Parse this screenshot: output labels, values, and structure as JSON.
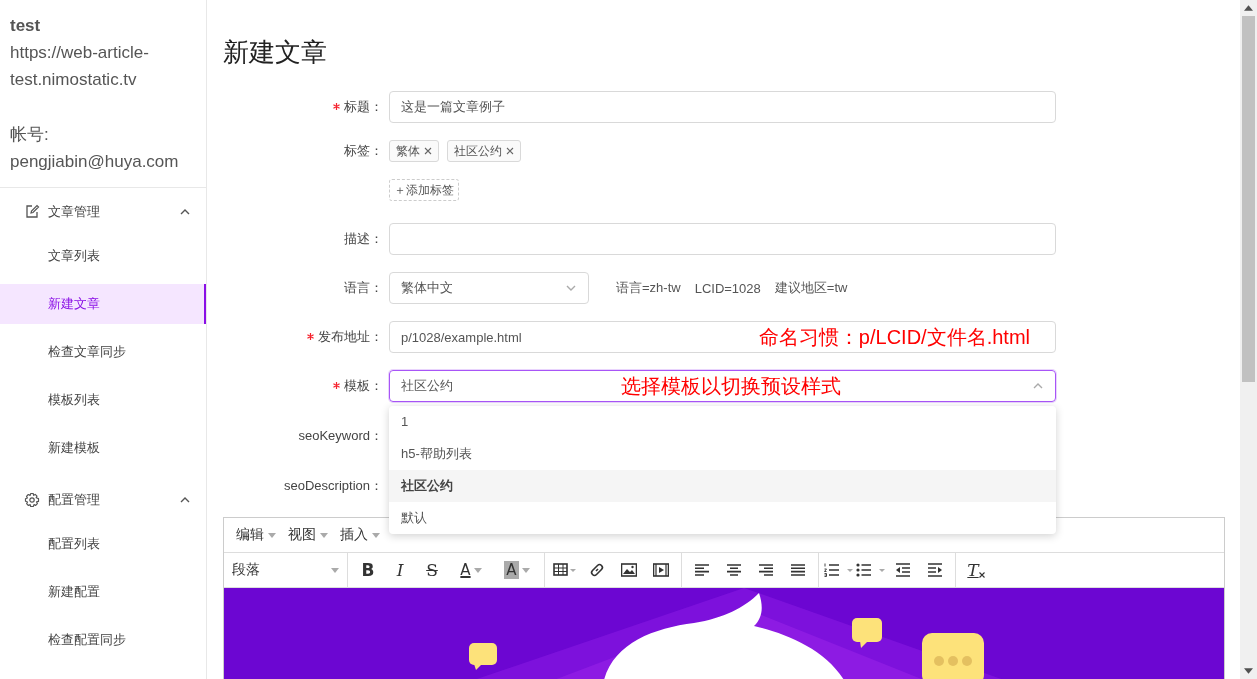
{
  "sidebar": {
    "site_name": "test",
    "site_url": "https://web-article-test.nimostatic.tv",
    "account_label": "帐号:",
    "account": "pengjiabin@huya.com",
    "menu": [
      {
        "label": "文章管理",
        "kind": "edit",
        "expanded": true,
        "children": [
          {
            "label": "文章列表",
            "selected": false
          },
          {
            "label": "新建文章",
            "selected": true
          },
          {
            "label": "检查文章同步",
            "selected": false
          },
          {
            "label": "模板列表",
            "selected": false
          },
          {
            "label": "新建模板",
            "selected": false
          }
        ]
      },
      {
        "label": "配置管理",
        "kind": "gear",
        "expanded": true,
        "children": [
          {
            "label": "配置列表",
            "selected": false
          },
          {
            "label": "新建配置",
            "selected": false
          },
          {
            "label": "检查配置同步",
            "selected": false
          }
        ]
      }
    ]
  },
  "page_title": "新建文章",
  "form": {
    "fields": [
      {
        "kind": "input",
        "label": "标题：",
        "required": true,
        "value": "这是一篇文章例子"
      },
      {
        "kind": "tags",
        "label": "标签：",
        "required": false,
        "tags": [
          "繁体",
          "社区公约"
        ],
        "add_label": "＋添加标签"
      },
      {
        "kind": "input",
        "label": "描述：",
        "required": false
      },
      {
        "kind": "select",
        "label": "语言：",
        "required": false,
        "value": "繁体中文",
        "expanded": false,
        "info": [
          "语言=zh-tw",
          "LCID=1028",
          "建议地区=tw"
        ]
      },
      {
        "kind": "input",
        "label": "发布地址：",
        "required": true,
        "value": "p/1028/example.html",
        "annotation": "命名习惯：p/LCID/文件名.html"
      },
      {
        "kind": "select",
        "label": "模板：",
        "required": true,
        "value": "社区公约",
        "expanded": true,
        "annotation": "选择模板以切换预设样式",
        "options": [
          {
            "label": "1",
            "selected": false
          },
          {
            "label": "h5-帮助列表",
            "selected": false
          },
          {
            "label": "社区公约",
            "selected": true
          },
          {
            "label": "默认",
            "selected": false
          }
        ]
      },
      {
        "kind": "covered",
        "label": "seoKeyword：",
        "required": false
      },
      {
        "kind": "covered",
        "label": "seoDescription：",
        "required": false
      }
    ]
  },
  "editor": {
    "menus": [
      "编辑",
      "视图",
      "插入"
    ],
    "toolbar": [
      {
        "kind": "select",
        "text": "段落"
      },
      {
        "kind": "sep"
      },
      {
        "kind": "bold",
        "text": "B"
      },
      {
        "kind": "italic",
        "text": "I"
      },
      {
        "kind": "strike",
        "text": "S"
      },
      {
        "kind": "color",
        "text": "A"
      },
      {
        "kind": "highlight",
        "text": "A"
      },
      {
        "kind": "sep"
      },
      {
        "kind": "icon"
      },
      {
        "kind": "icon"
      },
      {
        "kind": "icon"
      },
      {
        "kind": "icon"
      },
      {
        "kind": "sep"
      },
      {
        "kind": "icon"
      },
      {
        "kind": "icon"
      },
      {
        "kind": "icon"
      },
      {
        "kind": "icon"
      },
      {
        "kind": "sep"
      },
      {
        "kind": "icon"
      },
      {
        "kind": "icon"
      },
      {
        "kind": "icon"
      },
      {
        "kind": "icon"
      },
      {
        "kind": "sep"
      },
      {
        "kind": "clear",
        "text": "T"
      }
    ],
    "content": {
      "kind": "picture"
    }
  }
}
